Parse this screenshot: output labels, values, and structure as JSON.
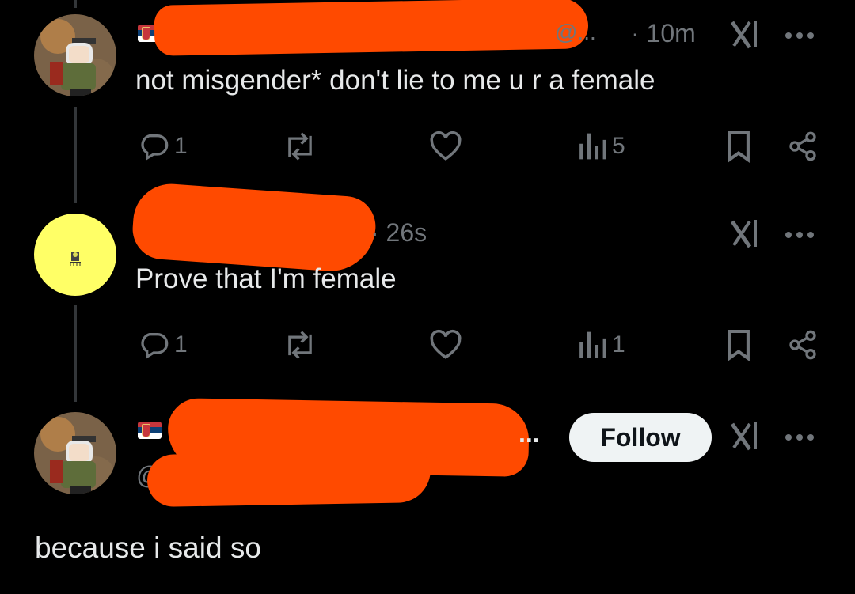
{
  "posts": [
    {
      "handle": "@...",
      "time": "· 10m",
      "text": "not misgender* don't lie to me u r a female",
      "replies": "1",
      "views": "5"
    },
    {
      "time": "· 26s",
      "text": "Prove that I'm female",
      "replies": "1",
      "views": "1"
    },
    {
      "handle_prefix": "@",
      "name_ellipsis": "...",
      "follow_label": "Follow",
      "text": "because i said so"
    }
  ],
  "icons": {
    "reply": "speech-bubble-icon",
    "repost": "repost-arrows-icon",
    "like": "heart-icon",
    "views": "bar-chart-icon",
    "bookmark": "bookmark-icon",
    "share": "share-nodes-icon",
    "grok": "grok-icon",
    "more": "three-dots-icon"
  },
  "colors": {
    "background": "#000000",
    "text": "#e7e9ea",
    "muted": "#71767b",
    "redaction": "#ff4a00",
    "follow_bg": "#eff3f4",
    "avatar_yellow": "#ffff66"
  }
}
